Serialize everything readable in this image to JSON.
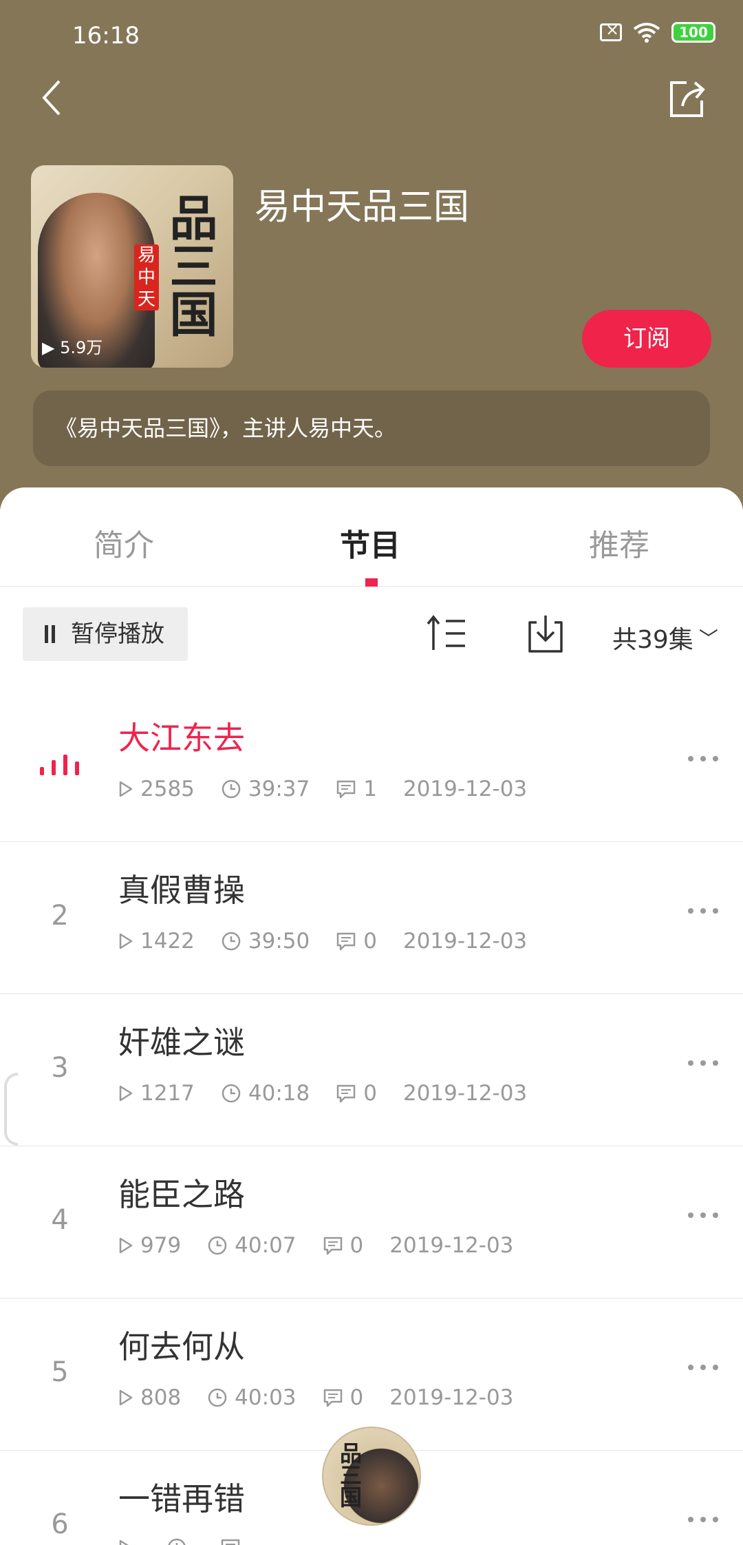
{
  "status_bar": {
    "time": "16:18",
    "battery": "100"
  },
  "album": {
    "title": "易中天品三国",
    "cover_calligraphy": "品三国",
    "cover_stamp": "易中天",
    "play_count": "▶ 5.9万",
    "subscribe_label": "订阅",
    "description": "《易中天品三国》，主讲人易中天。"
  },
  "tabs": [
    {
      "label": "简介"
    },
    {
      "label": "节目"
    },
    {
      "label": "推荐"
    }
  ],
  "toolbar": {
    "pause_label": "暂停播放",
    "episode_count": "共39集"
  },
  "episodes": [
    {
      "index": "",
      "title": "大江东去",
      "plays": "2585",
      "duration": "39:37",
      "comments": "1",
      "date": "2019-12-03",
      "playing": true
    },
    {
      "index": "2",
      "title": "真假曹操",
      "plays": "1422",
      "duration": "39:50",
      "comments": "0",
      "date": "2019-12-03"
    },
    {
      "index": "3",
      "title": "奸雄之谜",
      "plays": "1217",
      "duration": "40:18",
      "comments": "0",
      "date": "2019-12-03"
    },
    {
      "index": "4",
      "title": "能臣之路",
      "plays": "979",
      "duration": "40:07",
      "comments": "0",
      "date": "2019-12-03"
    },
    {
      "index": "5",
      "title": "何去何从",
      "plays": "808",
      "duration": "40:03",
      "comments": "0",
      "date": "2019-12-03"
    },
    {
      "index": "6",
      "title": "一错再错",
      "plays": "",
      "duration": "",
      "comments": "",
      "date": ""
    }
  ],
  "colors": {
    "header_bg": "#857658",
    "accent": "#f0234b"
  }
}
